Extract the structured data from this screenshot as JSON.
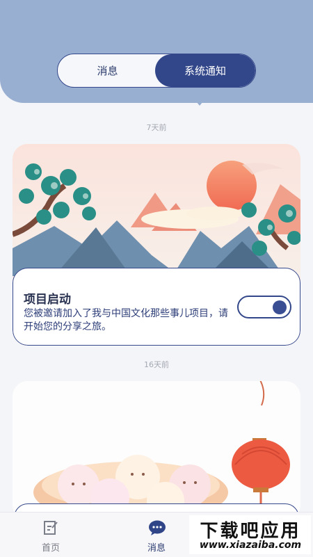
{
  "tabs": {
    "messages": "消息",
    "system": "系统通知"
  },
  "notifications": [
    {
      "time": "7天前",
      "title": "项目启动",
      "description": "您被邀请加入了我与中国文化那些事儿项目，请开始您的分享之旅。",
      "toggle_on": true
    },
    {
      "time": "16天前"
    }
  ],
  "bottom_nav": {
    "home": "首页",
    "messages": "消息"
  },
  "watermark": {
    "brand": "下载吧应用",
    "url": "www.xiazaiba.com"
  },
  "colors": {
    "accent": "#32478a",
    "header": "#98afd2"
  }
}
